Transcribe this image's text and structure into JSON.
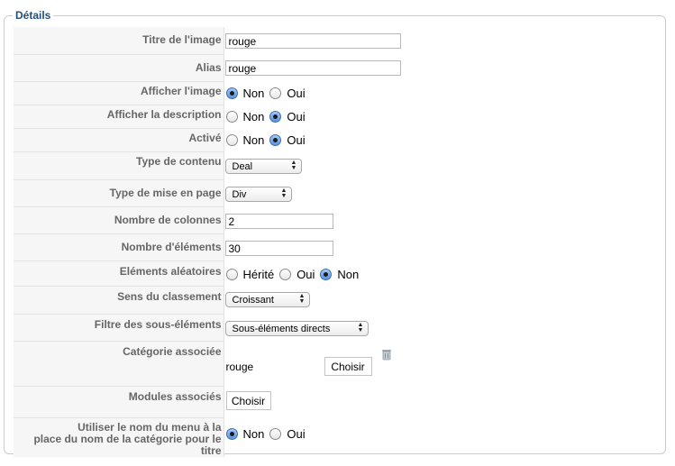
{
  "legend": "Détails",
  "fields": {
    "titre": {
      "label": "Titre de l'image",
      "value": "rouge"
    },
    "alias": {
      "label": "Alias",
      "value": "rouge"
    },
    "afficher_image": {
      "label": "Afficher l'image",
      "options": [
        "Non",
        "Oui"
      ],
      "selected": "Non"
    },
    "afficher_description": {
      "label": "Afficher la description",
      "options": [
        "Non",
        "Oui"
      ],
      "selected": "Oui"
    },
    "active": {
      "label": "Activé",
      "options": [
        "Non",
        "Oui"
      ],
      "selected": "Oui"
    },
    "type_contenu": {
      "label": "Type de contenu",
      "value": "Deal"
    },
    "type_mise_en_page": {
      "label": "Type de mise en page",
      "value": "Div"
    },
    "nombre_colonnes": {
      "label": "Nombre de colonnes",
      "value": "2"
    },
    "nombre_elements": {
      "label": "Nombre d'éléments",
      "value": "30"
    },
    "elements_aleatoires": {
      "label": "Eléments aléatoires",
      "options": [
        "Hérité",
        "Oui",
        "Non"
      ],
      "selected": "Non"
    },
    "sens_classement": {
      "label": "Sens du classement",
      "value": "Croissant"
    },
    "filtre_sous_elements": {
      "label": "Filtre des sous-éléments",
      "value": "Sous-éléments directs"
    },
    "categorie_associee": {
      "label": "Catégorie associée",
      "value": "rouge",
      "button": "Choisir",
      "icon": "trash-icon"
    },
    "modules_associes": {
      "label": "Modules associés",
      "button": "Choisir"
    },
    "utiliser_nom_menu": {
      "label_line1": "Utiliser le nom du menu à la",
      "label_line2": "place du nom de la catégorie pour le titre",
      "options": [
        "Non",
        "Oui"
      ],
      "selected": "Non"
    }
  }
}
